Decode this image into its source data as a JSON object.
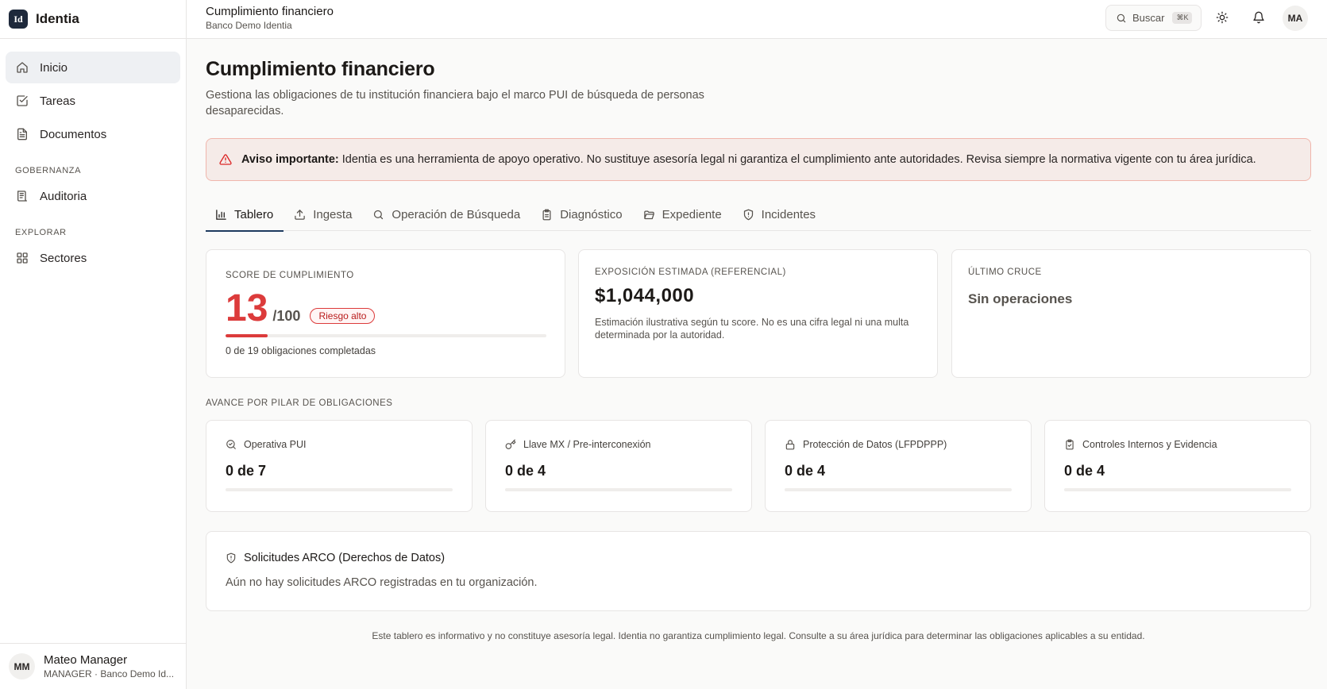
{
  "brand": {
    "logo_text": "Id",
    "name": "Identia"
  },
  "sidebar": {
    "items": [
      {
        "label": "Inicio",
        "icon": "home-icon",
        "active": true
      },
      {
        "label": "Tareas",
        "icon": "check-square-icon"
      },
      {
        "label": "Documentos",
        "icon": "file-text-icon"
      }
    ],
    "sections": [
      {
        "title": "GOBERNANZA",
        "items": [
          {
            "label": "Auditoria",
            "icon": "audit-log-icon"
          }
        ]
      },
      {
        "title": "EXPLORAR",
        "items": [
          {
            "label": "Sectores",
            "icon": "grid-icon"
          }
        ]
      }
    ],
    "user": {
      "initials": "MM",
      "name": "Mateo Manager",
      "role": "MANAGER · Banco Demo Id..."
    }
  },
  "topbar": {
    "title": "Cumplimiento financiero",
    "subtitle": "Banco Demo Identia",
    "search_label": "Buscar",
    "search_shortcut": "⌘K",
    "avatar_initials": "MA"
  },
  "page": {
    "title": "Cumplimiento financiero",
    "description": "Gestiona las obligaciones de tu institución financiera bajo el marco PUI de búsqueda de personas desaparecidas."
  },
  "alert": {
    "bold": "Aviso importante:",
    "text": "Identia es una herramienta de apoyo operativo. No sustituye asesoría legal ni garantiza el cumplimiento ante autoridades. Revisa siempre la normativa vigente con tu área jurídica."
  },
  "tabs": [
    {
      "label": "Tablero",
      "icon": "bar-chart-icon",
      "active": true
    },
    {
      "label": "Ingesta",
      "icon": "upload-icon"
    },
    {
      "label": "Operación de Búsqueda",
      "icon": "search-icon"
    },
    {
      "label": "Diagnóstico",
      "icon": "clipboard-icon"
    },
    {
      "label": "Expediente",
      "icon": "folder-open-icon"
    },
    {
      "label": "Incidentes",
      "icon": "shield-icon"
    }
  ],
  "score_card": {
    "label": "SCORE DE CUMPLIMIENTO",
    "score": "13",
    "max": "/100",
    "badge": "Riesgo alto",
    "progress": 0.13,
    "footnote": "0 de 19 obligaciones completadas"
  },
  "exposure_card": {
    "label": "EXPOSICIÓN ESTIMADA (REFERENCIAL)",
    "value": "$1,044,000",
    "note": "Estimación ilustrativa según tu score. No es una cifra legal ni una multa determinada por la autoridad."
  },
  "last_cross_card": {
    "label": "ÚLTIMO CRUCE",
    "value": "Sin operaciones"
  },
  "pillars": {
    "heading": "AVANCE POR PILAR DE OBLIGACIONES",
    "items": [
      {
        "title": "Operativa PUI",
        "icon": "search-check-icon",
        "value": "0 de 7",
        "progress": 0
      },
      {
        "title": "Llave MX / Pre-interconexión",
        "icon": "key-icon",
        "value": "0 de 4",
        "progress": 0
      },
      {
        "title": "Protección de Datos (LFPDPPP)",
        "icon": "lock-icon",
        "value": "0 de 4",
        "progress": 0
      },
      {
        "title": "Controles Internos y Evidencia",
        "icon": "clipboard-check-icon",
        "value": "0 de 4",
        "progress": 0
      }
    ]
  },
  "arco": {
    "title": "Solicitudes ARCO (Derechos de Datos)",
    "icon": "shield-icon",
    "empty": "Aún no hay solicitudes ARCO registradas en tu organización."
  },
  "footer": {
    "note": "Este tablero es informativo y no constituye asesoría legal. Identia no garantiza cumplimiento legal. Consulte a su área jurídica para determinar las obligaciones aplicables a su entidad."
  }
}
